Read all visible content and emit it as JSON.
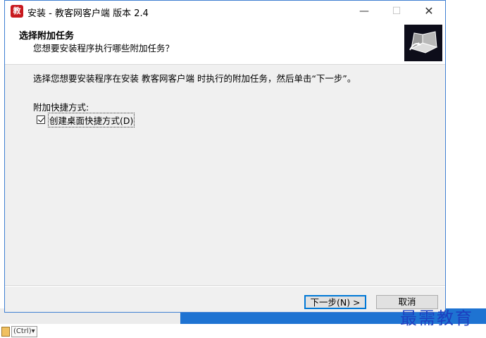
{
  "window": {
    "title": "安装 - 教客网客户端 版本 2.4",
    "icon_glyph": "教",
    "min_symbol": "—",
    "max_symbol": "☐",
    "close_symbol": "✕"
  },
  "header": {
    "title": "选择附加任务",
    "subtitle": "您想要安装程序执行哪些附加任务？"
  },
  "body": {
    "instruction": "选择您想要安装程序在安装 教客网客户端 时执行的附加任务，然后单击“下一步”。",
    "section_label": "附加快捷方式:",
    "checkbox_label": "创建桌面快捷方式(D)",
    "checkbox_checked": true
  },
  "buttons": {
    "next": "下一步(N) >",
    "cancel": "取消"
  },
  "status_bar": {
    "ctrl_label": "(Ctrl)▾"
  },
  "watermark": "最需教育",
  "colors": {
    "accent": "#0078d7",
    "icon_red": "#c8191e",
    "taskbar_blue": "#1e73d2",
    "watermark_blue": "#1d3fbf"
  }
}
